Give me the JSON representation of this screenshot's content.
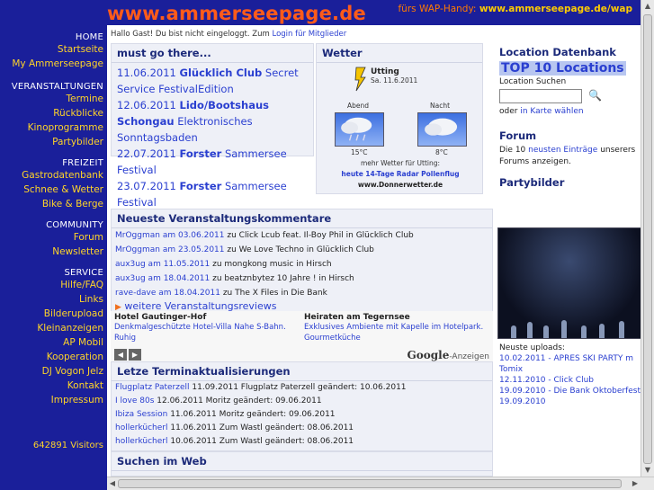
{
  "header": {
    "logo": "www.ammerseepage.de",
    "wap_prefix": "fürs WAP-Handy:",
    "wap_link": "www.ammerseepage.de/wap"
  },
  "sidebar": {
    "home": "HOME",
    "home_items": [
      "Startseite",
      "My Ammerseepage"
    ],
    "veranstaltungen": "VERANSTALTUNGEN",
    "veranstaltungen_items": [
      "Termine",
      "Rückblicke",
      "Kinoprogramme",
      "Partybilder"
    ],
    "freizeit": "FREIZEIT",
    "freizeit_items": [
      "Gastrodatenbank",
      "Schnee & Wetter",
      "Bike & Berge"
    ],
    "community": "COMMUNITY",
    "community_items": [
      "Forum",
      "Newsletter"
    ],
    "service": "SERVICE",
    "service_items": [
      "Hilfe/FAQ",
      "Links",
      "Bilderupload",
      "Kleinanzeigen",
      "AP Mobil",
      "Kooperation",
      "DJ Vogon Jelz",
      "Kontakt",
      "Impressum"
    ],
    "visitors": "642891 Visitors"
  },
  "greeting": {
    "text": "Hallo Gast! Du bist nicht eingeloggt. Zum",
    "link": "Login für Mitglieder"
  },
  "mustgo": {
    "title": "must go there...",
    "events": [
      {
        "date": "11.06.2011",
        "venue": "Glücklich Club",
        "name": "Secret Service FestivalEdition"
      },
      {
        "date": "12.06.2011",
        "venue": "Lido/Bootshaus Schongau",
        "name": "Elektronisches Sonntagsbaden"
      },
      {
        "date": "22.07.2011",
        "venue": "Forster",
        "name": "Sammersee Festival"
      },
      {
        "date": "23.07.2011",
        "venue": "Forster",
        "name": "Sammersee Festival"
      }
    ]
  },
  "wetter": {
    "title": "Wetter",
    "town": "Utting",
    "date": "Sa. 11.6.2011",
    "abend": "Abend",
    "nacht": "Nacht",
    "temp_abend": "15°C",
    "temp_nacht": "8°C",
    "mehr": "mehr Wetter für Utting:",
    "links": [
      "heute",
      "14-Tage",
      "Radar",
      "Pollenflug"
    ],
    "source": "www.Donnerwetter.de"
  },
  "kommentare": {
    "title": "Neueste Veranstaltungskommentare",
    "rows": [
      {
        "user": "MrOggman am 03.06.2011",
        "text": "zu Click Lcub feat. Il-Boy Phil in Glücklich Club"
      },
      {
        "user": "MrOggman am 23.05.2011",
        "text": "zu We Love Techno in Glücklich Club"
      },
      {
        "user": "aux3ug am 11.05.2011",
        "text": "zu mongkong music in Hirsch"
      },
      {
        "user": "aux3ug am 18.04.2011",
        "text": "zu beatznbytez 10 Jahre ! in Hirsch"
      },
      {
        "user": "rave-dave am 18.04.2011",
        "text": "zu The X Files in Die Bank"
      }
    ],
    "more": "weitere Veranstaltungsreviews"
  },
  "ads": {
    "left_title": "Hotel Gautinger-Hof",
    "left_desc": "Denkmalgeschützte Hotel-Villa Nahe S-Bahn. Ruhig",
    "right_title": "Heiraten am Tegernsee",
    "right_desc": "Exklusives Ambiente mit Kapelle im Hotelpark. Gourmetküche",
    "google_brand": "Google",
    "google_label": "-Anzeigen"
  },
  "termine": {
    "title": "Letze Terminaktualisierungen",
    "rows": [
      {
        "event": "Flugplatz Paterzell",
        "text": "11.09.2011 Flugplatz Paterzell geändert: 10.06.2011"
      },
      {
        "event": "I love 80s",
        "text": "12.06.2011 Moritz geändert: 09.06.2011"
      },
      {
        "event": "Ibiza Session",
        "text": "11.06.2011 Moritz geändert: 09.06.2011"
      },
      {
        "event": "hollerkücherl",
        "text": "11.06.2011 Zum Wastl geändert: 08.06.2011"
      },
      {
        "event": "hollerkücherl",
        "text": "10.06.2011 Zum Wastl geändert: 08.06.2011"
      }
    ]
  },
  "suchen": {
    "title": "Suchen im Web"
  },
  "location": {
    "title": "Location Datenbank",
    "top10": "TOP 10 Locations",
    "search_label": "Location Suchen",
    "oder": "oder",
    "karte": "in Karte wählen"
  },
  "forum": {
    "title": "Forum",
    "pre": "Die 10",
    "link": "neusten Einträge",
    "post": "unserers Forums anzeigen."
  },
  "partybilder": {
    "title": "Partybilder",
    "uploads_label": "Neuste uploads:",
    "uploads": [
      "10.02.2011 - APRES SKI PARTY m Tomix",
      "12.11.2010 - Click Club",
      "19.09.2010 - Die Bank Oktoberfest 19.09.2010"
    ]
  },
  "colors": {
    "sidebar_bg": "#1a1f9a",
    "nav_yellow": "#ffd428",
    "logo_orange": "#ff5b1a",
    "link_blue": "#2a3fd0",
    "box_bg": "#eef0f7"
  }
}
